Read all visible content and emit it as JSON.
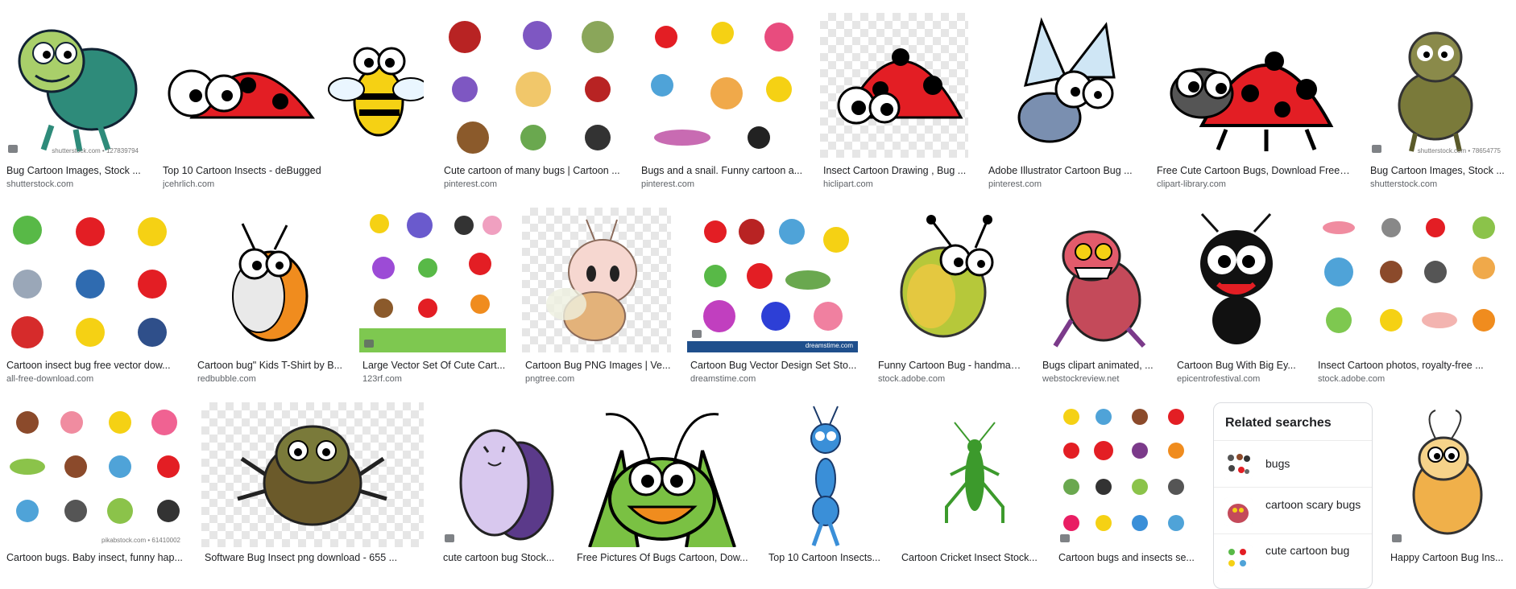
{
  "results": [
    {
      "title": "Bug Cartoon Images, Stock ...",
      "source": "shutterstock.com",
      "watermark": "shutterstock.com • 127839794",
      "photo": true
    },
    {
      "title": "Top 10 Cartoon Insects - deBugged",
      "source": "jcehrlich.com"
    },
    {
      "title": "Cute cartoon of many bugs | Cartoon ...",
      "source": "pinterest.com"
    },
    {
      "title": "Bugs and a snail. Funny cartoon a...",
      "source": "pinterest.com"
    },
    {
      "title": "Insect Cartoon Drawing , Bug ...",
      "source": "hiclipart.com"
    },
    {
      "title": "Adobe Illustrator Cartoon Bug ...",
      "source": "pinterest.com"
    },
    {
      "title": "Free Cute Cartoon Bugs, Download Free ...",
      "source": "clipart-library.com"
    },
    {
      "title": "Bug Cartoon Images, Stock ...",
      "source": "shutterstock.com",
      "watermark": "shutterstock.com • 78654775",
      "photo": true
    },
    {
      "title": "Cartoon insect bug free vector dow...",
      "source": "all-free-download.com"
    },
    {
      "title": "Cartoon bug\" Kids T-Shirt by B...",
      "source": "redbubble.com"
    },
    {
      "title": "Large Vector Set Of Cute Cart...",
      "source": "123rf.com",
      "photo": true
    },
    {
      "title": "Cartoon Bug PNG Images | Ve...",
      "source": "pngtree.com"
    },
    {
      "title": "Cartoon Bug Vector Design Set Sto...",
      "source": "dreamstime.com",
      "watermark": "dreamstime.com",
      "photo": true
    },
    {
      "title": "Funny Cartoon Bug - handmad...",
      "source": "stock.adobe.com"
    },
    {
      "title": "Bugs clipart animated, ...",
      "source": "webstockreview.net"
    },
    {
      "title": "Cartoon Bug With Big Ey...",
      "source": "epicentrofestival.com"
    },
    {
      "title": "Insect Cartoon photos, royalty-free ...",
      "source": "stock.adobe.com"
    },
    {
      "title": "Cartoon bugs. Baby insect, funny hap...",
      "source": "",
      "watermark": "pikabstock.com • 61410002"
    },
    {
      "title": "Software Bug Insect png download - 655 ...",
      "source": ""
    },
    {
      "title": "cute cartoon bug Stock...",
      "source": "",
      "photo": true
    },
    {
      "title": "Free Pictures Of Bugs Cartoon, Dow...",
      "source": ""
    },
    {
      "title": "Top 10 Cartoon Insects...",
      "source": ""
    },
    {
      "title": "Cartoon Cricket Insect Stock...",
      "source": ""
    },
    {
      "title": "Cartoon bugs and insects se...",
      "source": "",
      "photo": true
    },
    {
      "title": "Happy Cartoon Bug Ins...",
      "source": "",
      "photo": true
    }
  ],
  "related_searches": {
    "heading": "Related searches",
    "items": [
      {
        "label": "bugs"
      },
      {
        "label": "cartoon scary bugs"
      },
      {
        "label": "cute cartoon bug"
      }
    ]
  },
  "colors": {
    "title": "#202124",
    "source": "#5f6368",
    "border": "#dadce0",
    "ladybug": "#e31e24"
  }
}
